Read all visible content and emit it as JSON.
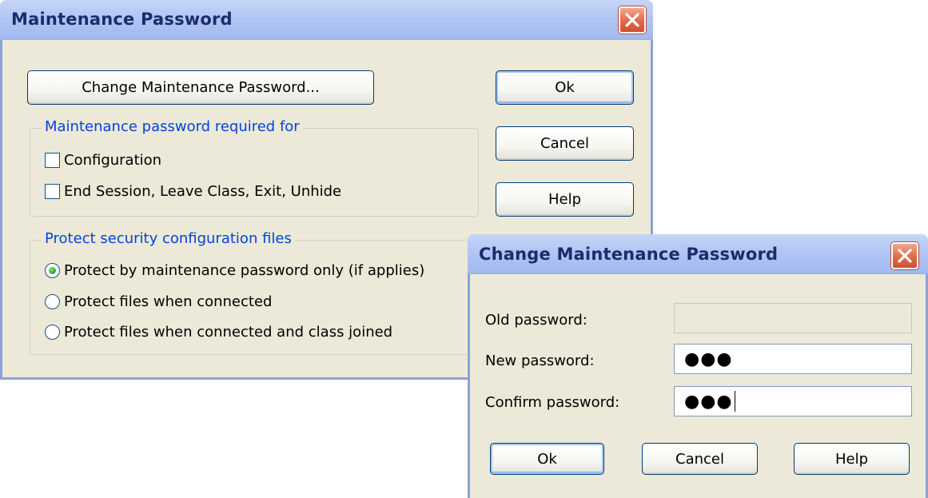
{
  "maintenance_dialog": {
    "title": "Maintenance Password",
    "change_button": "Change Maintenance Password...",
    "ok_button": "Ok",
    "cancel_button": "Cancel",
    "help_button": "Help",
    "required_group": {
      "legend": "Maintenance password required for",
      "items": [
        {
          "label": "Configuration",
          "checked": false
        },
        {
          "label": "End Session, Leave Class, Exit, Unhide",
          "checked": false
        }
      ]
    },
    "protect_group": {
      "legend": "Protect security configuration files",
      "options": [
        {
          "label": "Protect by maintenance password only (if applies)",
          "selected": true
        },
        {
          "label": "Protect files when connected",
          "selected": false
        },
        {
          "label": "Protect files when connected and class joined",
          "selected": false
        }
      ]
    }
  },
  "change_dialog": {
    "title": "Change Maintenance Password",
    "old_password_label": "Old password:",
    "old_password_value": "",
    "new_password_label": "New password:",
    "new_password_value": "●●●",
    "confirm_password_label": "Confirm password:",
    "confirm_password_value": "●●●",
    "ok_button": "Ok",
    "cancel_button": "Cancel",
    "help_button": "Help"
  },
  "colors": {
    "title_text": "#1d2b6c",
    "dialog_face": "#ece9d8",
    "group_legend": "#0046d5",
    "close_button": "#e06a4c"
  }
}
